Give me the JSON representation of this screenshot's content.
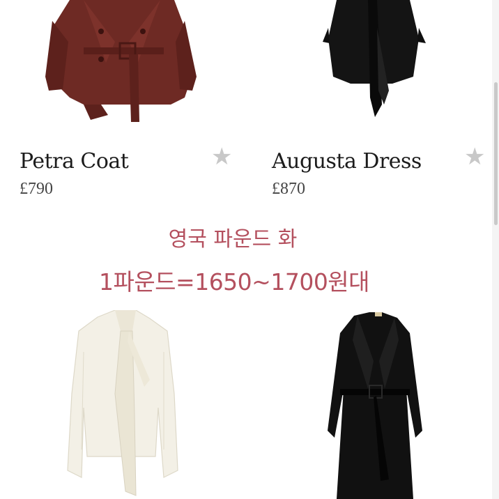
{
  "products": [
    {
      "name": "Petra Coat",
      "price": "£790"
    },
    {
      "name": "Augusta Dress",
      "price": "£870"
    },
    {
      "name": "",
      "price": ""
    },
    {
      "name": "",
      "price": ""
    }
  ],
  "note": {
    "line1": "영국 파운드 화",
    "line2": "1파운드=1650~1700원대"
  },
  "colors": {
    "note_text": "#b4505e",
    "coat_burgundy": "#6e2a24",
    "dress_black": "#141414",
    "blouse_cream": "#f3f0e6",
    "favorite_star": "#c8c8c8"
  }
}
